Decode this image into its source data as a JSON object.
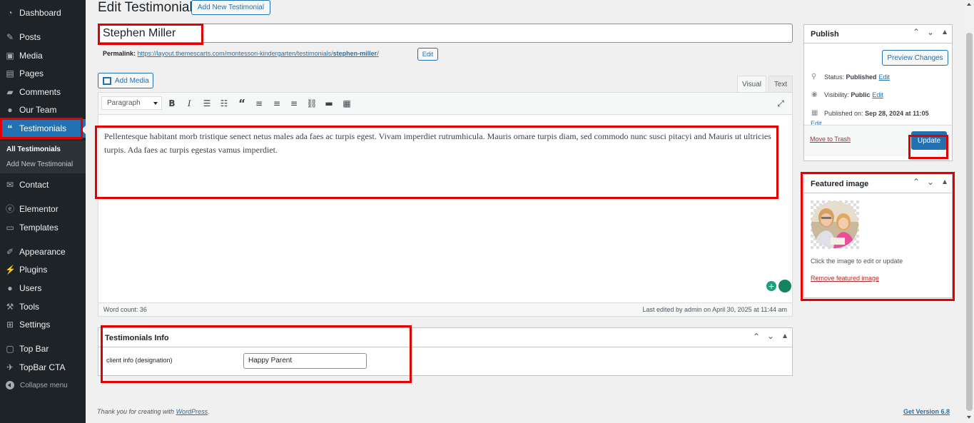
{
  "sidebar": {
    "items": [
      {
        "label": "Dashboard",
        "icon": "dashboard-icon"
      },
      {
        "label": "Posts",
        "icon": "pin-icon"
      },
      {
        "label": "Media",
        "icon": "media-icon"
      },
      {
        "label": "Pages",
        "icon": "pages-icon"
      },
      {
        "label": "Comments",
        "icon": "comments-icon"
      },
      {
        "label": "Our Team",
        "icon": "team-icon"
      },
      {
        "label": "Testimonials",
        "icon": "quote-icon"
      },
      {
        "label": "Contact",
        "icon": "mail-icon"
      },
      {
        "label": "Elementor",
        "icon": "elementor-icon"
      },
      {
        "label": "Templates",
        "icon": "folder-icon"
      },
      {
        "label": "Appearance",
        "icon": "brush-icon"
      },
      {
        "label": "Plugins",
        "icon": "plugin-icon"
      },
      {
        "label": "Users",
        "icon": "user-icon"
      },
      {
        "label": "Tools",
        "icon": "wrench-icon"
      },
      {
        "label": "Settings",
        "icon": "settings-icon"
      },
      {
        "label": "Top Bar",
        "icon": "window-icon"
      },
      {
        "label": "TopBar CTA",
        "icon": "cta-icon"
      }
    ],
    "submenu": [
      "All Testimonials",
      "Add New Testimonial"
    ],
    "collapse_label": "Collapse menu"
  },
  "header": {
    "title": "Edit Testimonial",
    "add_new_label": "Add New Testimonial"
  },
  "post": {
    "title": "Stephen Miller",
    "permalink_label": "Permalink:",
    "permalink_base": "https://layout.themescarts.com/montessori-kindergarten/testimonials/",
    "permalink_slug": "stephen-miller",
    "permalink_tail": "/",
    "permalink_edit": "Edit"
  },
  "editor": {
    "add_media_label": "Add Media",
    "tab_visual": "Visual",
    "tab_text": "Text",
    "format_value": "Paragraph",
    "content": "Pellentesque habitant morb tristique senect netus males ada faes ac turpis egest. Vivam imperdiet rutrumhicula. Mauris ornare turpis diam, sed commodo nunc susci pitacyi and Mauris ut ultricies turpis. Ada faes ac turpis egestas vamus imperdiet.",
    "word_count": "Word count: 36",
    "last_edited": "Last edited by admin on April 30, 2025 at 11:44 am"
  },
  "metabox": {
    "title": "Testimonials Info",
    "field_label": "client info (designation)",
    "field_value": "Happy Parent"
  },
  "publish": {
    "title": "Publish",
    "preview_label": "Preview Changes",
    "status_label": "Status:",
    "status_value": "Published",
    "visibility_label": "Visibility:",
    "visibility_value": "Public",
    "published_label": "Published on:",
    "published_value": "Sep 28, 2024 at 11:05",
    "edit_label": "Edit",
    "trash_label": "Move to Trash",
    "update_label": "Update"
  },
  "featured": {
    "title": "Featured image",
    "help": "Click the image to edit or update",
    "remove": "Remove featured image"
  },
  "footer": {
    "thanks_prefix": "Thank you for creating with ",
    "thanks_link": "WordPress",
    "thanks_suffix": ".",
    "version": "Get Version 6.8"
  },
  "colors": {
    "sidebar_bg": "#1d2327",
    "accent": "#2271b1",
    "highlight_box": "#e30000",
    "danger": "#b32d2e"
  }
}
